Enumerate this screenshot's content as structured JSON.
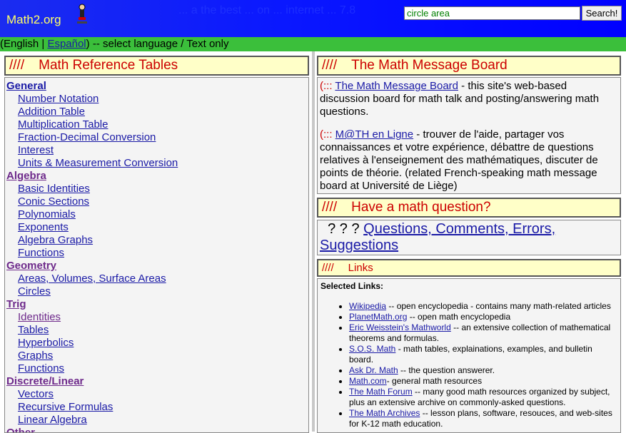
{
  "header": {
    "brand": "Math2.org",
    "ghost_text": "... a the best ... on ... internet ... 7.8",
    "search": {
      "value": "circle area",
      "button_label": "Search!"
    }
  },
  "language_bar": {
    "open_paren": "(",
    "english": "English",
    "separator": " | ",
    "espanol": "Español",
    "rest": ") -- select language / Text only"
  },
  "reference": {
    "marks": "////",
    "title": "Math Reference Tables",
    "sections": [
      {
        "label": "General",
        "visited": false,
        "items": [
          {
            "label": "Number Notation",
            "visited": false
          },
          {
            "label": "Addition Table",
            "visited": false
          },
          {
            "label": "Multiplication Table",
            "visited": false
          },
          {
            "label": "Fraction-Decimal Conversion",
            "visited": false
          },
          {
            "label": "Interest",
            "visited": false
          },
          {
            "label": "Units & Measurement Conversion",
            "visited": false
          }
        ]
      },
      {
        "label": "Algebra",
        "visited": true,
        "items": [
          {
            "label": "Basic Identities",
            "visited": false
          },
          {
            "label": "Conic Sections",
            "visited": false
          },
          {
            "label": "Polynomials",
            "visited": false
          },
          {
            "label": "Exponents",
            "visited": false
          },
          {
            "label": "Algebra Graphs",
            "visited": false
          },
          {
            "label": "Functions",
            "visited": false
          }
        ]
      },
      {
        "label": "Geometry",
        "visited": true,
        "items": [
          {
            "label": "Areas, Volumes, Surface Areas",
            "visited": false
          },
          {
            "label": "Circles",
            "visited": false
          }
        ]
      },
      {
        "label": "Trig",
        "visited": true,
        "items": [
          {
            "label": "Identities",
            "visited": true
          },
          {
            "label": "Tables",
            "visited": false
          },
          {
            "label": "Hyperbolics",
            "visited": false
          },
          {
            "label": "Graphs",
            "visited": false
          },
          {
            "label": "Functions",
            "visited": false
          }
        ]
      },
      {
        "label": "Discrete/Linear",
        "visited": true,
        "items": [
          {
            "label": "Vectors",
            "visited": false
          },
          {
            "label": "Recursive Formulas",
            "visited": false
          },
          {
            "label": "Linear Algebra",
            "visited": false
          }
        ]
      },
      {
        "label": "Other",
        "visited": true,
        "items": []
      }
    ]
  },
  "message_board": {
    "marks": "////",
    "title": "The Math Message Board",
    "entries": [
      {
        "prefix": "(:::",
        "link": "The Math Message Board",
        "text": " - this site's web-based discussion board for math talk and posting/answering math questions."
      },
      {
        "prefix": "(:::",
        "link": "M@TH en Ligne",
        "text": " - trouver de l'aide, partager vos connaissances et votre expérience, débattre de questions relatives à l'enseignement des mathématiques, discuter de points de théorie. (related French-speaking math message board at Université de Liège)"
      }
    ]
  },
  "question": {
    "marks": "////",
    "title": "Have a math question?",
    "prefix": "? ? ?",
    "link": "Questions, Comments, Errors, Suggestions"
  },
  "links": {
    "marks": "////",
    "title": "Links",
    "selected_label": "Selected Links:",
    "items": [
      {
        "link": "Wikipedia",
        "text": " -- open encyclopedia - contains many math-related articles"
      },
      {
        "link": "PlanetMath.org",
        "text": " -- open math encyclopedia"
      },
      {
        "link": "Eric Weisstein's Mathworld",
        "text": " -- an extensive collection of mathematical theorems and formulas."
      },
      {
        "link": "S.O.S. Math",
        "text": " - math tables, explainations, examples, and bulletin board."
      },
      {
        "link": "Ask Dr. Math",
        "text": " -- the question answerer."
      },
      {
        "link": "Math.com",
        "text": "- general math resources"
      },
      {
        "link": "The Math Forum",
        "text": " -- many good math resources organized by subject, plus an extensive archive on commonly-asked questions."
      },
      {
        "link": "The Math Archives",
        "text": " -- lesson plans, software, resouces, and web-sites for K-12 math education."
      }
    ]
  }
}
